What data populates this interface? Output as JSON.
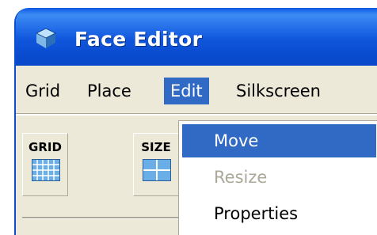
{
  "window": {
    "title": "Face Editor",
    "icon": "cube-icon",
    "titlebar_color": "#0a4cd0"
  },
  "menubar": {
    "items": [
      {
        "label": "Grid"
      },
      {
        "label": "Place"
      },
      {
        "label": "Edit",
        "active": true
      },
      {
        "label": "Silkscreen"
      }
    ],
    "highlight_color": "#316ac5"
  },
  "toolbar": {
    "buttons": [
      {
        "label": "GRID",
        "icon": "grid-icon"
      },
      {
        "label": "SIZE",
        "icon": "size-icon"
      }
    ]
  },
  "edit_menu": {
    "items": [
      {
        "label": "Move",
        "state": "highlighted"
      },
      {
        "label": "Resize",
        "state": "disabled"
      },
      {
        "label": "Properties",
        "state": "enabled"
      }
    ]
  }
}
